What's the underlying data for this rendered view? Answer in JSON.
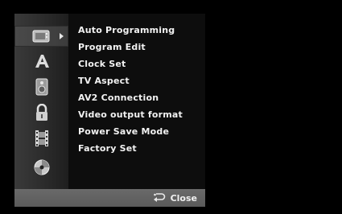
{
  "menu": {
    "items": [
      {
        "label": "Auto Programming"
      },
      {
        "label": "Program Edit"
      },
      {
        "label": "Clock Set"
      },
      {
        "label": "TV Aspect"
      },
      {
        "label": "AV2 Connection"
      },
      {
        "label": "Video output format"
      },
      {
        "label": "Power Save Mode"
      },
      {
        "label": "Factory Set"
      }
    ]
  },
  "categories": [
    {
      "icon": "tv-icon",
      "selected": true
    },
    {
      "icon": "language-a-icon",
      "selected": false
    },
    {
      "icon": "speaker-icon",
      "selected": false
    },
    {
      "icon": "lock-icon",
      "selected": false
    },
    {
      "icon": "film-icon",
      "selected": false
    },
    {
      "icon": "disc-icon",
      "selected": false
    }
  ],
  "footer": {
    "close_label": "Close",
    "return_icon": "return-icon"
  }
}
